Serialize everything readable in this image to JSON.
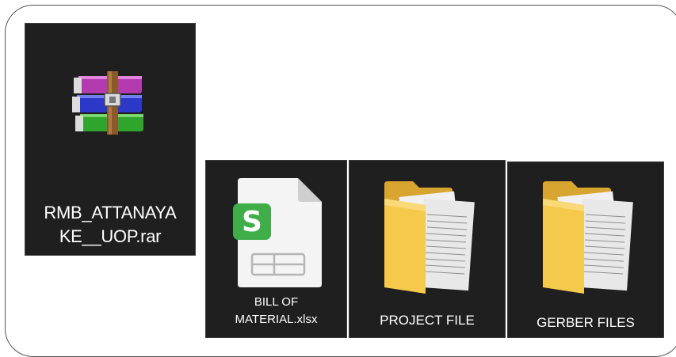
{
  "desktop": {
    "files": [
      {
        "name": "RMB_ATTANAYA",
        "name2": "KE__UOP.rar",
        "icon": "winrar-archive-icon",
        "type": "rar"
      },
      {
        "name": "BILL OF",
        "name2": "MATERIAL.xlsx",
        "icon": "spreadsheet-icon",
        "type": "xlsx"
      },
      {
        "name": "PROJECT FILE",
        "icon": "folder-icon",
        "type": "folder"
      },
      {
        "name": "GERBER FILES",
        "icon": "folder-icon",
        "type": "folder"
      }
    ]
  },
  "colors": {
    "tile_bg": "#1f1f1f",
    "text": "#ffffff",
    "folder_yellow": "#f5c94c",
    "sheet_green": "#3fae49"
  }
}
